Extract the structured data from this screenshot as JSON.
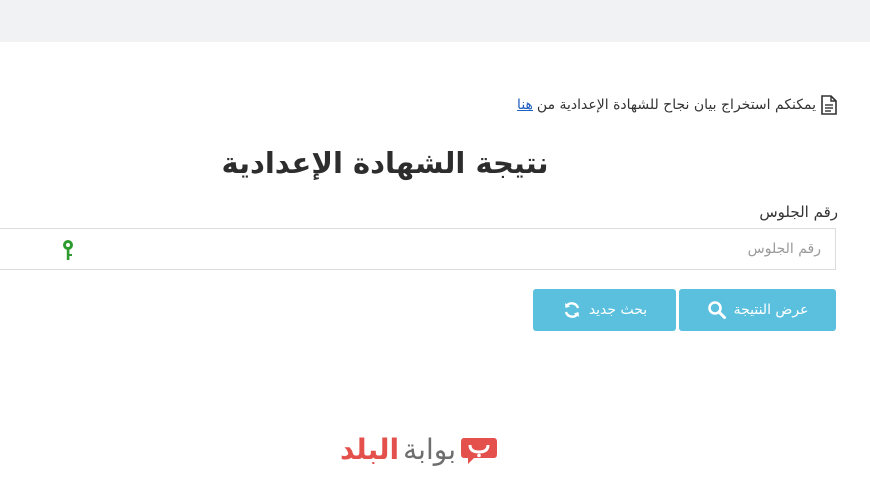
{
  "notice": {
    "text": "يمكنكم استخراج بيان نجاح للشهادة الإعدادية من",
    "link_label": "هنا"
  },
  "page_title": "نتيجة الشهادة الإعدادية",
  "seat_number": {
    "label": "رقم الجلوس",
    "placeholder": "رقم الجلوس",
    "value": ""
  },
  "buttons": {
    "show_result": "عرض النتيجة",
    "new_search": "بحث جديد"
  },
  "watermark": {
    "part1": "بوابة",
    "part2": "البلد"
  },
  "icons": {
    "notice": "document-icon",
    "input_addon": "key-icon",
    "show_result": "search-icon",
    "new_search": "refresh-icon",
    "watermark": "logo-mark"
  },
  "colors": {
    "button": "#5bc0de",
    "link": "#1f5fbf",
    "key_icon": "#2e9b2e",
    "watermark_red": "#e0322c",
    "topbar": "#f1f2f4"
  }
}
